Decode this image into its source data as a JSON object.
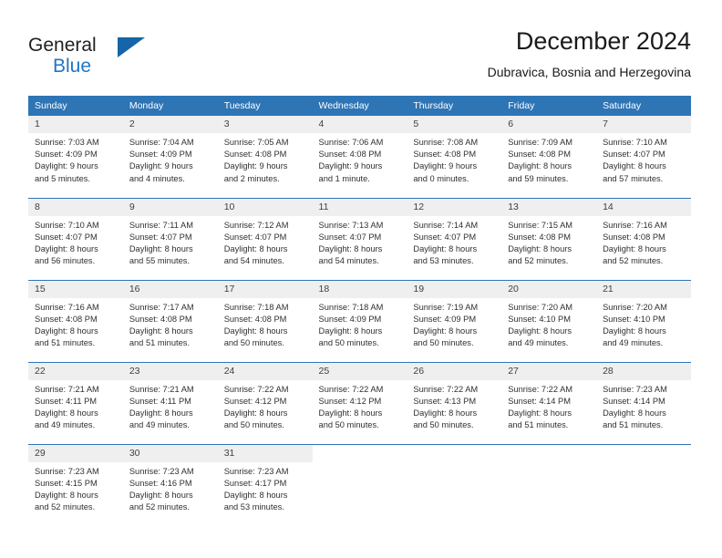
{
  "logo": {
    "line1": "General",
    "line2": "Blue",
    "mark": "triangle-icon"
  },
  "header": {
    "title": "December 2024",
    "subtitle": "Dubravica, Bosnia and Herzegovina"
  },
  "calendar": {
    "weekday_headers": [
      "Sunday",
      "Monday",
      "Tuesday",
      "Wednesday",
      "Thursday",
      "Friday",
      "Saturday"
    ],
    "colors": {
      "header_background": "#2e75b6",
      "header_text": "#ffffff",
      "daynum_background": "#efefef",
      "row_divider": "#2e75b6",
      "logo_blue": "#1f76c4",
      "logo_triangle": "#1565a8"
    },
    "weeks": [
      [
        {
          "day": "1",
          "sunrise": "Sunrise: 7:03 AM",
          "sunset": "Sunset: 4:09 PM",
          "daylight1": "Daylight: 9 hours",
          "daylight2": "and 5 minutes."
        },
        {
          "day": "2",
          "sunrise": "Sunrise: 7:04 AM",
          "sunset": "Sunset: 4:09 PM",
          "daylight1": "Daylight: 9 hours",
          "daylight2": "and 4 minutes."
        },
        {
          "day": "3",
          "sunrise": "Sunrise: 7:05 AM",
          "sunset": "Sunset: 4:08 PM",
          "daylight1": "Daylight: 9 hours",
          "daylight2": "and 2 minutes."
        },
        {
          "day": "4",
          "sunrise": "Sunrise: 7:06 AM",
          "sunset": "Sunset: 4:08 PM",
          "daylight1": "Daylight: 9 hours",
          "daylight2": "and 1 minute."
        },
        {
          "day": "5",
          "sunrise": "Sunrise: 7:08 AM",
          "sunset": "Sunset: 4:08 PM",
          "daylight1": "Daylight: 9 hours",
          "daylight2": "and 0 minutes."
        },
        {
          "day": "6",
          "sunrise": "Sunrise: 7:09 AM",
          "sunset": "Sunset: 4:08 PM",
          "daylight1": "Daylight: 8 hours",
          "daylight2": "and 59 minutes."
        },
        {
          "day": "7",
          "sunrise": "Sunrise: 7:10 AM",
          "sunset": "Sunset: 4:07 PM",
          "daylight1": "Daylight: 8 hours",
          "daylight2": "and 57 minutes."
        }
      ],
      [
        {
          "day": "8",
          "sunrise": "Sunrise: 7:10 AM",
          "sunset": "Sunset: 4:07 PM",
          "daylight1": "Daylight: 8 hours",
          "daylight2": "and 56 minutes."
        },
        {
          "day": "9",
          "sunrise": "Sunrise: 7:11 AM",
          "sunset": "Sunset: 4:07 PM",
          "daylight1": "Daylight: 8 hours",
          "daylight2": "and 55 minutes."
        },
        {
          "day": "10",
          "sunrise": "Sunrise: 7:12 AM",
          "sunset": "Sunset: 4:07 PM",
          "daylight1": "Daylight: 8 hours",
          "daylight2": "and 54 minutes."
        },
        {
          "day": "11",
          "sunrise": "Sunrise: 7:13 AM",
          "sunset": "Sunset: 4:07 PM",
          "daylight1": "Daylight: 8 hours",
          "daylight2": "and 54 minutes."
        },
        {
          "day": "12",
          "sunrise": "Sunrise: 7:14 AM",
          "sunset": "Sunset: 4:07 PM",
          "daylight1": "Daylight: 8 hours",
          "daylight2": "and 53 minutes."
        },
        {
          "day": "13",
          "sunrise": "Sunrise: 7:15 AM",
          "sunset": "Sunset: 4:08 PM",
          "daylight1": "Daylight: 8 hours",
          "daylight2": "and 52 minutes."
        },
        {
          "day": "14",
          "sunrise": "Sunrise: 7:16 AM",
          "sunset": "Sunset: 4:08 PM",
          "daylight1": "Daylight: 8 hours",
          "daylight2": "and 52 minutes."
        }
      ],
      [
        {
          "day": "15",
          "sunrise": "Sunrise: 7:16 AM",
          "sunset": "Sunset: 4:08 PM",
          "daylight1": "Daylight: 8 hours",
          "daylight2": "and 51 minutes."
        },
        {
          "day": "16",
          "sunrise": "Sunrise: 7:17 AM",
          "sunset": "Sunset: 4:08 PM",
          "daylight1": "Daylight: 8 hours",
          "daylight2": "and 51 minutes."
        },
        {
          "day": "17",
          "sunrise": "Sunrise: 7:18 AM",
          "sunset": "Sunset: 4:08 PM",
          "daylight1": "Daylight: 8 hours",
          "daylight2": "and 50 minutes."
        },
        {
          "day": "18",
          "sunrise": "Sunrise: 7:18 AM",
          "sunset": "Sunset: 4:09 PM",
          "daylight1": "Daylight: 8 hours",
          "daylight2": "and 50 minutes."
        },
        {
          "day": "19",
          "sunrise": "Sunrise: 7:19 AM",
          "sunset": "Sunset: 4:09 PM",
          "daylight1": "Daylight: 8 hours",
          "daylight2": "and 50 minutes."
        },
        {
          "day": "20",
          "sunrise": "Sunrise: 7:20 AM",
          "sunset": "Sunset: 4:10 PM",
          "daylight1": "Daylight: 8 hours",
          "daylight2": "and 49 minutes."
        },
        {
          "day": "21",
          "sunrise": "Sunrise: 7:20 AM",
          "sunset": "Sunset: 4:10 PM",
          "daylight1": "Daylight: 8 hours",
          "daylight2": "and 49 minutes."
        }
      ],
      [
        {
          "day": "22",
          "sunrise": "Sunrise: 7:21 AM",
          "sunset": "Sunset: 4:11 PM",
          "daylight1": "Daylight: 8 hours",
          "daylight2": "and 49 minutes."
        },
        {
          "day": "23",
          "sunrise": "Sunrise: 7:21 AM",
          "sunset": "Sunset: 4:11 PM",
          "daylight1": "Daylight: 8 hours",
          "daylight2": "and 49 minutes."
        },
        {
          "day": "24",
          "sunrise": "Sunrise: 7:22 AM",
          "sunset": "Sunset: 4:12 PM",
          "daylight1": "Daylight: 8 hours",
          "daylight2": "and 50 minutes."
        },
        {
          "day": "25",
          "sunrise": "Sunrise: 7:22 AM",
          "sunset": "Sunset: 4:12 PM",
          "daylight1": "Daylight: 8 hours",
          "daylight2": "and 50 minutes."
        },
        {
          "day": "26",
          "sunrise": "Sunrise: 7:22 AM",
          "sunset": "Sunset: 4:13 PM",
          "daylight1": "Daylight: 8 hours",
          "daylight2": "and 50 minutes."
        },
        {
          "day": "27",
          "sunrise": "Sunrise: 7:22 AM",
          "sunset": "Sunset: 4:14 PM",
          "daylight1": "Daylight: 8 hours",
          "daylight2": "and 51 minutes."
        },
        {
          "day": "28",
          "sunrise": "Sunrise: 7:23 AM",
          "sunset": "Sunset: 4:14 PM",
          "daylight1": "Daylight: 8 hours",
          "daylight2": "and 51 minutes."
        }
      ],
      [
        {
          "day": "29",
          "sunrise": "Sunrise: 7:23 AM",
          "sunset": "Sunset: 4:15 PM",
          "daylight1": "Daylight: 8 hours",
          "daylight2": "and 52 minutes."
        },
        {
          "day": "30",
          "sunrise": "Sunrise: 7:23 AM",
          "sunset": "Sunset: 4:16 PM",
          "daylight1": "Daylight: 8 hours",
          "daylight2": "and 52 minutes."
        },
        {
          "day": "31",
          "sunrise": "Sunrise: 7:23 AM",
          "sunset": "Sunset: 4:17 PM",
          "daylight1": "Daylight: 8 hours",
          "daylight2": "and 53 minutes."
        },
        {
          "day": "",
          "sunrise": "",
          "sunset": "",
          "daylight1": "",
          "daylight2": ""
        },
        {
          "day": "",
          "sunrise": "",
          "sunset": "",
          "daylight1": "",
          "daylight2": ""
        },
        {
          "day": "",
          "sunrise": "",
          "sunset": "",
          "daylight1": "",
          "daylight2": ""
        },
        {
          "day": "",
          "sunrise": "",
          "sunset": "",
          "daylight1": "",
          "daylight2": ""
        }
      ]
    ]
  }
}
